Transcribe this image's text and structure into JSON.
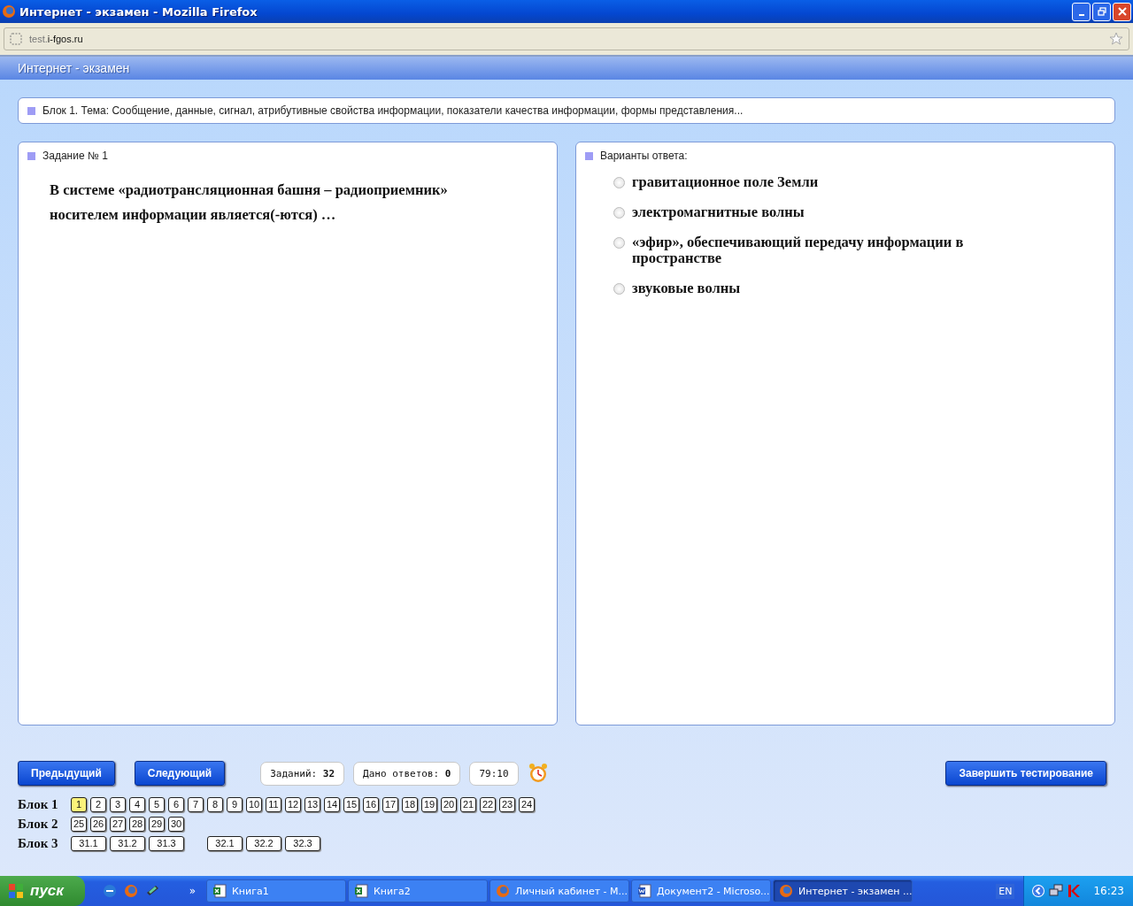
{
  "window": {
    "title": "Интернет - экзамен - Mozilla Firefox"
  },
  "address_bar": {
    "subdomain": "test.",
    "domain": "i-fgos.ru"
  },
  "app_header": {
    "title": "Интернет - экзамен"
  },
  "topic": "Блок 1. Тема: Сообщение, данные, сигнал, атрибутивные свойства информации, показатели качества информации, формы представления...",
  "task": {
    "heading": "Задание № 1",
    "text": "В системе «радиотрансляционная башня – радиоприемник» носителем информации является(-ются) …"
  },
  "answers": {
    "heading": "Варианты ответа:",
    "options": [
      {
        "label": "гравитационное поле Земли",
        "selected": false
      },
      {
        "label": "электромагнитные волны",
        "selected": false
      },
      {
        "label": "«эфир», обеспечивающий передачу информации в пространстве",
        "selected": false
      },
      {
        "label": "звуковые волны",
        "selected": false
      }
    ]
  },
  "navigation": {
    "previous": "Предыдущий",
    "next": "Следующий",
    "finish": "Завершить тестирование"
  },
  "counters": [
    {
      "label": "Заданий:",
      "value": "32"
    },
    {
      "label": "Дано ответов:",
      "value": "0"
    }
  ],
  "timer": "79:10",
  "blocks": [
    {
      "label": "Блок 1",
      "groups": [
        [
          {
            "label": "1",
            "selected": true
          },
          {
            "label": "2",
            "selected": false
          },
          {
            "label": "3",
            "selected": false
          },
          {
            "label": "4",
            "selected": false
          },
          {
            "label": "5",
            "selected": false
          },
          {
            "label": "6",
            "selected": false
          },
          {
            "label": "7",
            "selected": false
          },
          {
            "label": "8",
            "selected": false
          },
          {
            "label": "9",
            "selected": false
          },
          {
            "label": "10",
            "selected": false
          },
          {
            "label": "11",
            "selected": false
          },
          {
            "label": "12",
            "selected": false
          },
          {
            "label": "13",
            "selected": false
          },
          {
            "label": "14",
            "selected": false
          },
          {
            "label": "15",
            "selected": false
          },
          {
            "label": "16",
            "selected": false
          },
          {
            "label": "17",
            "selected": false
          },
          {
            "label": "18",
            "selected": false
          },
          {
            "label": "19",
            "selected": false
          },
          {
            "label": "20",
            "selected": false
          },
          {
            "label": "21",
            "selected": false
          },
          {
            "label": "22",
            "selected": false
          },
          {
            "label": "23",
            "selected": false
          },
          {
            "label": "24",
            "selected": false
          }
        ]
      ]
    },
    {
      "label": "Блок 2",
      "groups": [
        [
          {
            "label": "25",
            "selected": false
          },
          {
            "label": "26",
            "selected": false
          },
          {
            "label": "27",
            "selected": false
          },
          {
            "label": "28",
            "selected": false
          },
          {
            "label": "29",
            "selected": false
          },
          {
            "label": "30",
            "selected": false
          }
        ]
      ]
    },
    {
      "label": "Блок 3",
      "groups": [
        [
          {
            "label": "31.1",
            "selected": false
          },
          {
            "label": "31.2",
            "selected": false
          },
          {
            "label": "31.3",
            "selected": false
          }
        ],
        [
          {
            "label": "32.1",
            "selected": false
          },
          {
            "label": "32.2",
            "selected": false
          },
          {
            "label": "32.3",
            "selected": false
          }
        ]
      ]
    }
  ],
  "taskbar": {
    "start": "пуск",
    "quick_launch_more": "»",
    "tasks": [
      {
        "label": "Книга1",
        "kind": "excel",
        "selected": false
      },
      {
        "label": "Книга2",
        "kind": "excel",
        "selected": false
      },
      {
        "label": "Личный кабинет - М...",
        "kind": "firefox",
        "selected": false
      },
      {
        "label": "Документ2 - Microso...",
        "kind": "word",
        "selected": false
      },
      {
        "label": "Интернет - экзамен ...",
        "kind": "firefox",
        "selected": true
      }
    ],
    "language": "EN",
    "clock": "16:23"
  }
}
